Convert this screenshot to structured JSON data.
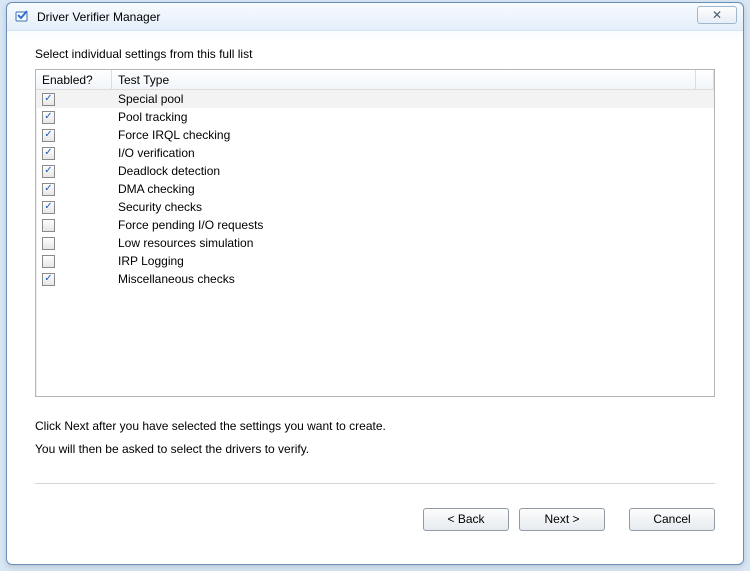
{
  "window": {
    "title": "Driver Verifier Manager",
    "close_glyph": "✕"
  },
  "instruction": "Select individual settings from this full list",
  "columns": {
    "enabled": "Enabled?",
    "testtype": "Test Type"
  },
  "rows": [
    {
      "checked": true,
      "label": "Special pool",
      "selected": true
    },
    {
      "checked": true,
      "label": "Pool tracking"
    },
    {
      "checked": true,
      "label": "Force IRQL checking"
    },
    {
      "checked": true,
      "label": "I/O verification"
    },
    {
      "checked": true,
      "label": "Deadlock detection"
    },
    {
      "checked": true,
      "label": "DMA checking"
    },
    {
      "checked": true,
      "label": "Security checks"
    },
    {
      "checked": false,
      "label": "Force pending I/O requests"
    },
    {
      "checked": false,
      "label": "Low resources simulation"
    },
    {
      "checked": false,
      "label": "IRP Logging"
    },
    {
      "checked": true,
      "label": "Miscellaneous checks"
    }
  ],
  "help": {
    "line1": "Click Next after you have selected the settings you want to create.",
    "line2": "You will then be asked to select the drivers to verify."
  },
  "buttons": {
    "back": "< Back",
    "next": "Next >",
    "cancel": "Cancel"
  },
  "checkmark": "✓"
}
